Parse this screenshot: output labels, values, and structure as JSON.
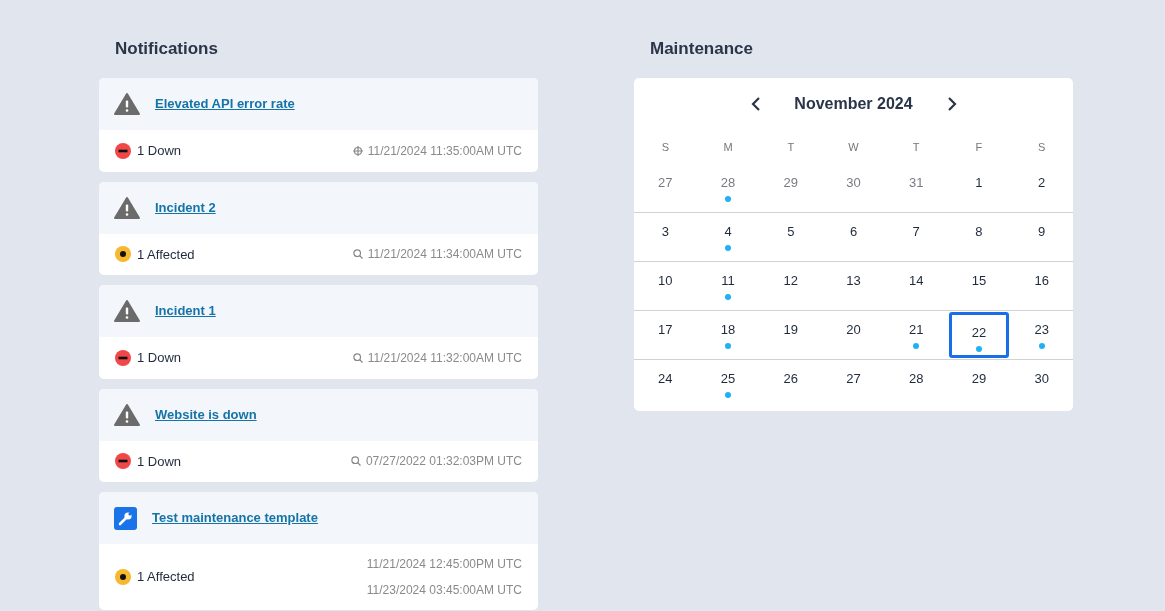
{
  "notifications": {
    "title": "Notifications",
    "items": [
      {
        "kind": "incident",
        "title": "Elevated API error rate",
        "status": {
          "kind": "down",
          "label": "1 Down"
        },
        "times": [
          {
            "kind": "target",
            "text": "11/21/2024 11:35:00AM UTC"
          }
        ]
      },
      {
        "kind": "incident",
        "title": "Incident 2",
        "status": {
          "kind": "affected",
          "label": "1 Affected"
        },
        "times": [
          {
            "kind": "search",
            "text": "11/21/2024 11:34:00AM UTC"
          }
        ]
      },
      {
        "kind": "incident",
        "title": "Incident 1",
        "status": {
          "kind": "down",
          "label": "1 Down"
        },
        "times": [
          {
            "kind": "search",
            "text": "11/21/2024 11:32:00AM UTC"
          }
        ]
      },
      {
        "kind": "incident",
        "title": "Website is down",
        "status": {
          "kind": "down",
          "label": "1 Down"
        },
        "times": [
          {
            "kind": "search",
            "text": "07/27/2022 01:32:03PM UTC"
          }
        ]
      },
      {
        "kind": "maintenance",
        "title": "Test maintenance template",
        "status": {
          "kind": "affected",
          "label": "1 Affected"
        },
        "times": [
          {
            "kind": "plain",
            "text": "11/21/2024 12:45:00PM UTC"
          },
          {
            "kind": "plain",
            "text": "11/23/2024 03:45:00AM UTC"
          }
        ]
      }
    ]
  },
  "maintenance": {
    "title": "Maintenance",
    "month": "November 2024",
    "weekdays": [
      "S",
      "M",
      "T",
      "W",
      "T",
      "F",
      "S"
    ],
    "weeks": [
      [
        {
          "day": "27",
          "outside": true,
          "event": false,
          "selected": false
        },
        {
          "day": "28",
          "outside": true,
          "event": true,
          "selected": false
        },
        {
          "day": "29",
          "outside": true,
          "event": false,
          "selected": false
        },
        {
          "day": "30",
          "outside": true,
          "event": false,
          "selected": false
        },
        {
          "day": "31",
          "outside": true,
          "event": false,
          "selected": false
        },
        {
          "day": "1",
          "outside": false,
          "event": false,
          "selected": false
        },
        {
          "day": "2",
          "outside": false,
          "event": false,
          "selected": false
        }
      ],
      [
        {
          "day": "3",
          "outside": false,
          "event": false,
          "selected": false
        },
        {
          "day": "4",
          "outside": false,
          "event": true,
          "selected": false
        },
        {
          "day": "5",
          "outside": false,
          "event": false,
          "selected": false
        },
        {
          "day": "6",
          "outside": false,
          "event": false,
          "selected": false
        },
        {
          "day": "7",
          "outside": false,
          "event": false,
          "selected": false
        },
        {
          "day": "8",
          "outside": false,
          "event": false,
          "selected": false
        },
        {
          "day": "9",
          "outside": false,
          "event": false,
          "selected": false
        }
      ],
      [
        {
          "day": "10",
          "outside": false,
          "event": false,
          "selected": false
        },
        {
          "day": "11",
          "outside": false,
          "event": true,
          "selected": false
        },
        {
          "day": "12",
          "outside": false,
          "event": false,
          "selected": false
        },
        {
          "day": "13",
          "outside": false,
          "event": false,
          "selected": false
        },
        {
          "day": "14",
          "outside": false,
          "event": false,
          "selected": false
        },
        {
          "day": "15",
          "outside": false,
          "event": false,
          "selected": false
        },
        {
          "day": "16",
          "outside": false,
          "event": false,
          "selected": false
        }
      ],
      [
        {
          "day": "17",
          "outside": false,
          "event": false,
          "selected": false
        },
        {
          "day": "18",
          "outside": false,
          "event": true,
          "selected": false
        },
        {
          "day": "19",
          "outside": false,
          "event": false,
          "selected": false
        },
        {
          "day": "20",
          "outside": false,
          "event": false,
          "selected": false
        },
        {
          "day": "21",
          "outside": false,
          "event": true,
          "selected": false
        },
        {
          "day": "22",
          "outside": false,
          "event": true,
          "selected": true
        },
        {
          "day": "23",
          "outside": false,
          "event": true,
          "selected": false
        }
      ],
      [
        {
          "day": "24",
          "outside": false,
          "event": false,
          "selected": false
        },
        {
          "day": "25",
          "outside": false,
          "event": true,
          "selected": false
        },
        {
          "day": "26",
          "outside": false,
          "event": false,
          "selected": false
        },
        {
          "day": "27",
          "outside": false,
          "event": false,
          "selected": false
        },
        {
          "day": "28",
          "outside": false,
          "event": false,
          "selected": false
        },
        {
          "day": "29",
          "outside": false,
          "event": false,
          "selected": false
        },
        {
          "day": "30",
          "outside": false,
          "event": false,
          "selected": false
        }
      ]
    ]
  }
}
